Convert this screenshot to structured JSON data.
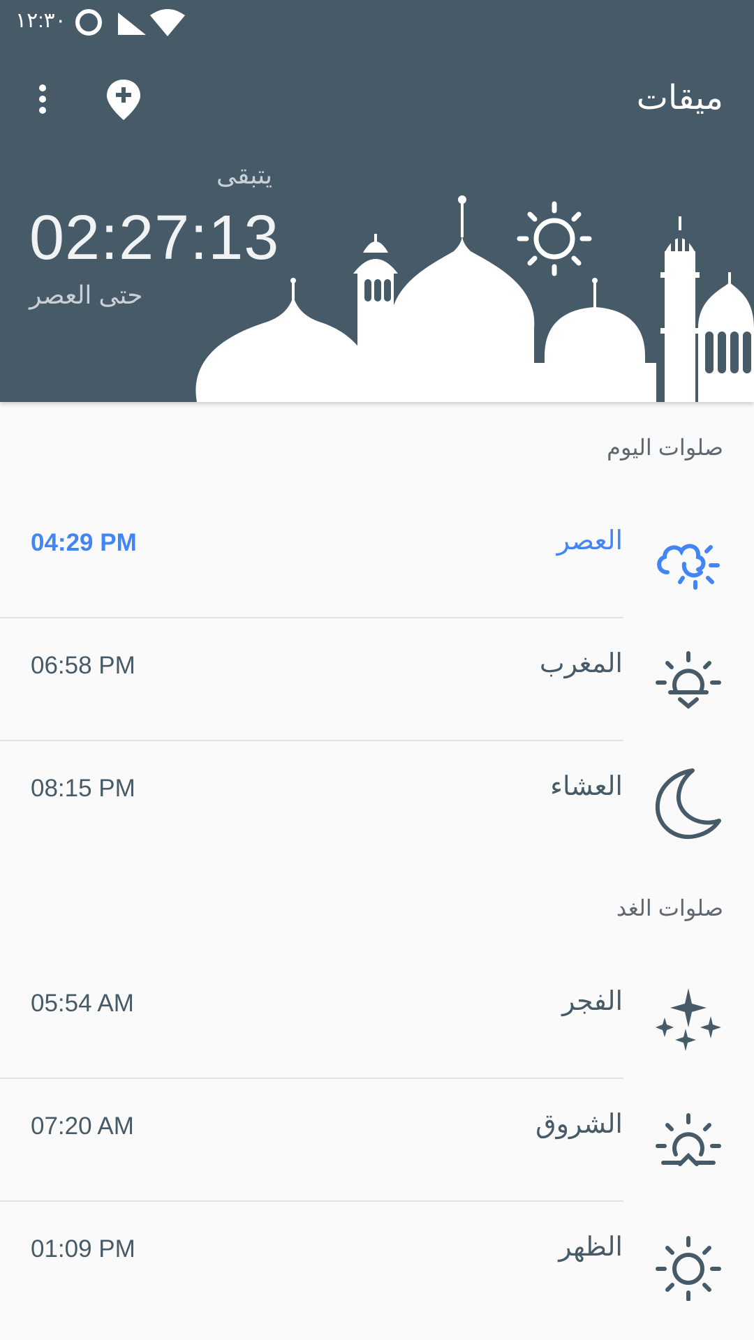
{
  "status_bar": {
    "time": "١٢:٣٠"
  },
  "app_bar": {
    "title": "ميقات"
  },
  "countdown": {
    "remaining_label": "يتبقى",
    "value": "02:27:13",
    "until_label": "حتى العصر"
  },
  "today": {
    "section_title": "صلوات اليوم",
    "prayers": [
      {
        "name": "العصر",
        "time": "04:29 PM",
        "icon": "cloud-sun-icon",
        "active": true
      },
      {
        "name": "المغرب",
        "time": "06:58 PM",
        "icon": "sunset-icon",
        "active": false
      },
      {
        "name": "العشاء",
        "time": "08:15 PM",
        "icon": "crescent-moon-icon",
        "active": false
      }
    ]
  },
  "tomorrow": {
    "section_title": "صلوات الغد",
    "prayers": [
      {
        "name": "الفجر",
        "time": "05:54 AM",
        "icon": "stars-icon",
        "active": false
      },
      {
        "name": "الشروق",
        "time": "07:20 AM",
        "icon": "sunrise-icon",
        "active": false
      },
      {
        "name": "الظهر",
        "time": "01:09 PM",
        "icon": "sun-icon",
        "active": false
      }
    ]
  },
  "colors": {
    "header_bg": "#475a68",
    "accent": "#4285f4",
    "text": "#475a68",
    "background": "#fafafa"
  }
}
